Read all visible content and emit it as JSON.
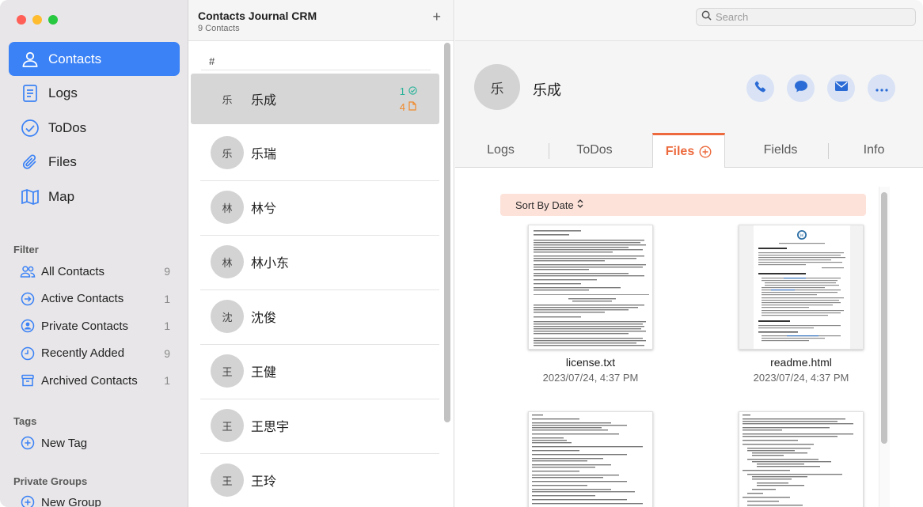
{
  "sidebar": {
    "nav": [
      {
        "label": "Contacts",
        "icon": "person-icon",
        "active": true
      },
      {
        "label": "Logs",
        "icon": "document-icon",
        "active": false
      },
      {
        "label": "ToDos",
        "icon": "checkmark-circle-icon",
        "active": false
      },
      {
        "label": "Files",
        "icon": "paperclip-icon",
        "active": false
      },
      {
        "label": "Map",
        "icon": "map-icon",
        "active": false
      }
    ],
    "filter_title": "Filter",
    "filters": [
      {
        "label": "All Contacts",
        "count": "9",
        "icon": "people-icon"
      },
      {
        "label": "Active Contacts",
        "count": "1",
        "icon": "arrow-circle-icon"
      },
      {
        "label": "Private Contacts",
        "count": "1",
        "icon": "person-circle-icon"
      },
      {
        "label": "Recently Added",
        "count": "9",
        "icon": "clock-icon"
      },
      {
        "label": "Archived Contacts",
        "count": "1",
        "icon": "archive-box-icon"
      }
    ],
    "tags_title": "Tags",
    "new_tag": "New Tag",
    "groups_title": "Private Groups",
    "new_group": "New Group"
  },
  "contact_list": {
    "title": "Contacts Journal CRM",
    "subtitle": "9 Contacts",
    "add_label": "+",
    "section": "#",
    "contacts": [
      {
        "initial": "乐",
        "name": "乐成",
        "selected": true,
        "todo_count": "1",
        "file_count": "4"
      },
      {
        "initial": "乐",
        "name": "乐瑞"
      },
      {
        "initial": "林",
        "name": "林兮"
      },
      {
        "initial": "林",
        "name": "林小东"
      },
      {
        "initial": "沈",
        "name": "沈俊"
      },
      {
        "initial": "王",
        "name": "王健"
      },
      {
        "initial": "王",
        "name": "王思宇"
      },
      {
        "initial": "王",
        "name": "王玲"
      }
    ]
  },
  "detail": {
    "search_placeholder": "Search",
    "initial": "乐",
    "name": "乐成",
    "actions": [
      "phone-icon",
      "message-bubble-icon",
      "envelope-icon",
      "more-ellipsis-icon"
    ],
    "tabs": [
      {
        "label": "Logs"
      },
      {
        "label": "ToDos"
      },
      {
        "label": "Files",
        "active": true
      },
      {
        "label": "Fields"
      },
      {
        "label": "Info"
      }
    ],
    "sort_label": "Sort By Date",
    "files": [
      {
        "name": "license.txt",
        "date": "2023/07/24, 4:37 PM"
      },
      {
        "name": "readme.html",
        "date": "2023/07/24, 4:37 PM"
      }
    ]
  },
  "colors": {
    "accent_blue": "#3b82f6",
    "tab_active": "#ec6a3d",
    "todo_badge": "#2bb39a",
    "file_badge": "#f08a2b",
    "sort_bar": "#fde2da",
    "action_bg": "#d9e3f5"
  }
}
